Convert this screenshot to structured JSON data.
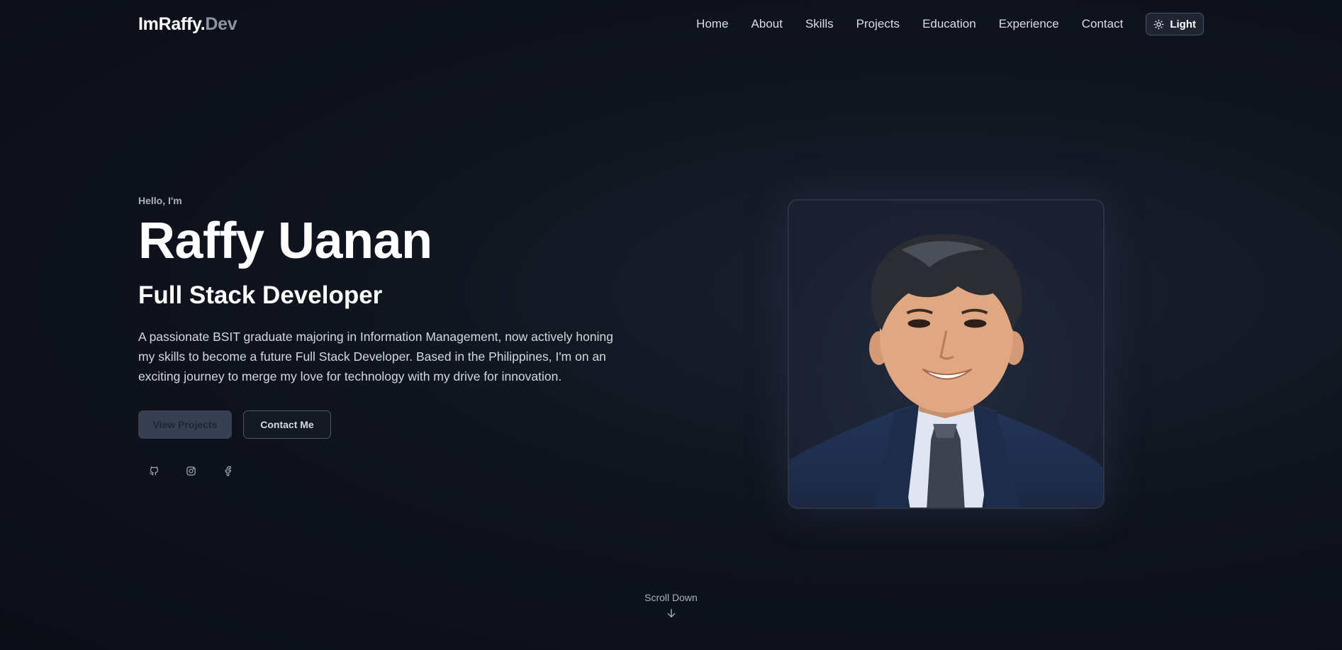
{
  "nav": {
    "logo_main": "ImRaffy.",
    "logo_accent": "Dev",
    "links": [
      "Home",
      "About",
      "Skills",
      "Projects",
      "Education",
      "Experience",
      "Contact"
    ],
    "theme_label": "Light",
    "theme_icon": "sun-icon"
  },
  "hero": {
    "greeting": "Hello, I'm",
    "name": "Raffy Uanan",
    "role": "Full Stack Developer",
    "bio": "A passionate BSIT graduate majoring in Information Management, now actively honing my skills to become a future Full Stack Developer. Based in the Philippines, I'm on an exciting journey to merge my love for technology with my drive for innovation.",
    "primary_button": "View Projects",
    "secondary_button": "Contact Me",
    "socials": [
      "github-icon",
      "instagram-icon",
      "facebook-icon"
    ]
  },
  "portrait": {
    "icon": "profile-photo"
  },
  "scroll": {
    "label": "Scroll Down",
    "icon": "arrow-down-icon"
  },
  "colors": {
    "background": "#10141e",
    "text": "#ffffff",
    "accent_muted": "#8b94a3"
  }
}
